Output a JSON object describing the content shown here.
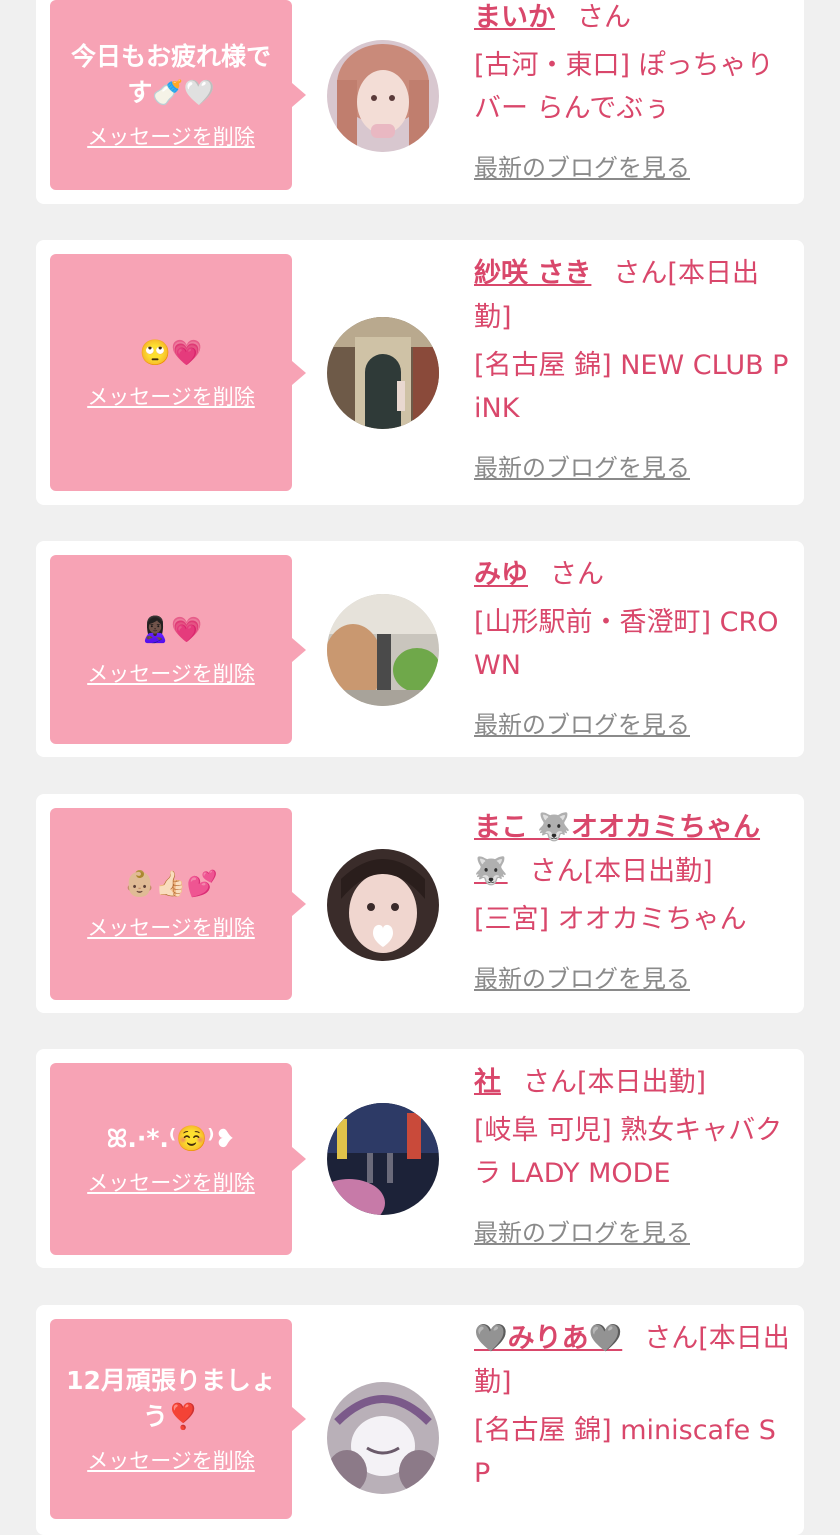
{
  "delete_label": "メッセージを削除",
  "blog_label": "最新のブログを見る",
  "accent_color": "#d9476b",
  "bubble_color": "#f7a3b5",
  "items": [
    {
      "message": "今日もお疲れ様です🍼🤍",
      "name": "まいか",
      "honorific": "さん",
      "status": "",
      "shop": "[古河・東口] ぽっちゃりバー らんでぶぅ"
    },
    {
      "message": "🙄💗",
      "name": "紗咲 さき",
      "honorific": "さん",
      "status": "[本日出勤]",
      "shop": "[名古屋 錦] NEW CLUB PiNK"
    },
    {
      "message": "🙎🏿‍♀️💗",
      "name": "みゆ",
      "honorific": "さん",
      "status": "",
      "shop": "[山形駅前・香澄町] CROWN"
    },
    {
      "message": "👶🏼👍🏻💕",
      "name": "まこ 🐺オオカミちゃん🐺",
      "honorific": "さん",
      "status": "[本日出勤]",
      "shop": "[三宮] オオカミちゃん"
    },
    {
      "message": "ꕤ.·*.⁽☺️⁾❥",
      "name": "社",
      "honorific": "さん",
      "status": "[本日出勤]",
      "shop": "[岐阜 可児] 熟女キャバクラ LADY MODE"
    },
    {
      "message": "12月頑張りましょう❣️",
      "name": "🩶みりあ🩶",
      "honorific": "さん",
      "status": "[本日出勤]",
      "shop": "[名古屋 錦] miniscafe SP"
    }
  ]
}
